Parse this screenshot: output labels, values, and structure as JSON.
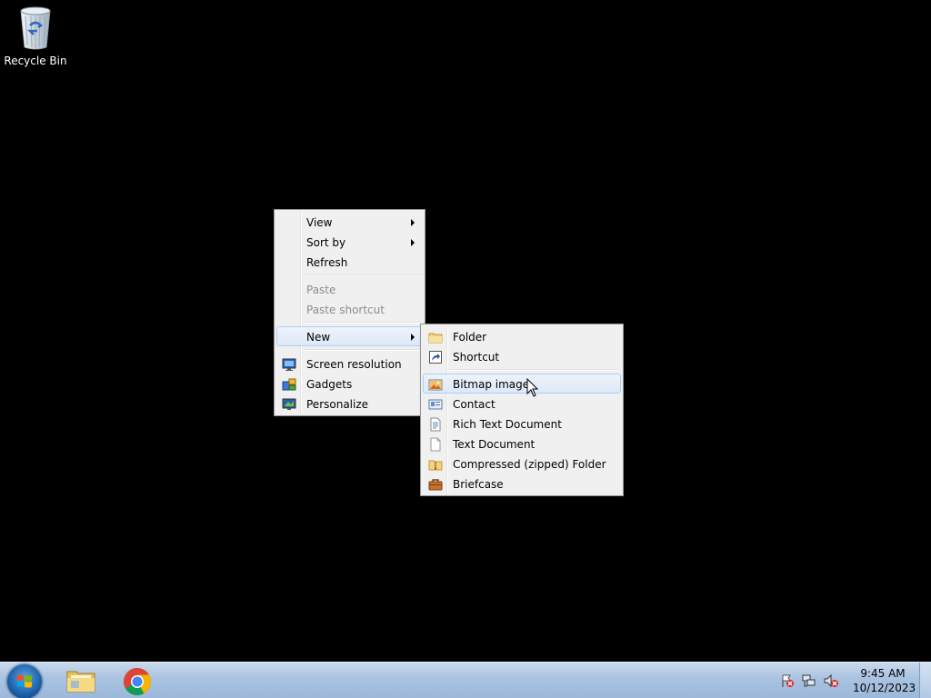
{
  "desktop": {
    "icons": [
      {
        "label": "Recycle Bin",
        "icon": "recycle-bin-icon"
      }
    ]
  },
  "context_menu": {
    "items": [
      {
        "label": "View",
        "submenu": true
      },
      {
        "label": "Sort by",
        "submenu": true
      },
      {
        "label": "Refresh"
      },
      {
        "label": "Paste",
        "disabled": true
      },
      {
        "label": "Paste shortcut",
        "disabled": true
      },
      {
        "label": "New",
        "submenu": true,
        "active": true
      },
      {
        "label": "Screen resolution",
        "icon": "monitor-icon"
      },
      {
        "label": "Gadgets",
        "icon": "gadgets-icon"
      },
      {
        "label": "Personalize",
        "icon": "personalize-icon"
      }
    ]
  },
  "new_submenu": {
    "items": [
      {
        "label": "Folder",
        "icon": "folder-icon"
      },
      {
        "label": "Shortcut",
        "icon": "shortcut-icon"
      },
      {
        "label": "Bitmap image",
        "icon": "bitmap-icon",
        "hovered": true
      },
      {
        "label": "Contact",
        "icon": "contact-icon"
      },
      {
        "label": "Rich Text Document",
        "icon": "rich-text-icon"
      },
      {
        "label": "Text Document",
        "icon": "text-document-icon"
      },
      {
        "label": "Compressed (zipped) Folder",
        "icon": "zip-folder-icon"
      },
      {
        "label": "Briefcase",
        "icon": "briefcase-icon"
      }
    ]
  },
  "taskbar": {
    "pinned": [
      {
        "name": "Windows Explorer",
        "icon": "explorer-folder-icon"
      },
      {
        "name": "Google Chrome",
        "icon": "chrome-icon"
      }
    ],
    "clock": {
      "time": "9:45 AM",
      "date": "10/12/2023"
    },
    "tray_icons": [
      "action-center-flag-icon",
      "network-icon",
      "volume-muted-icon"
    ]
  },
  "colors": {
    "desktop_background": "#000000",
    "menu_background": "#f0f0f0",
    "menu_highlight_border": "#aecff7",
    "taskbar": "#a9c3e0"
  }
}
